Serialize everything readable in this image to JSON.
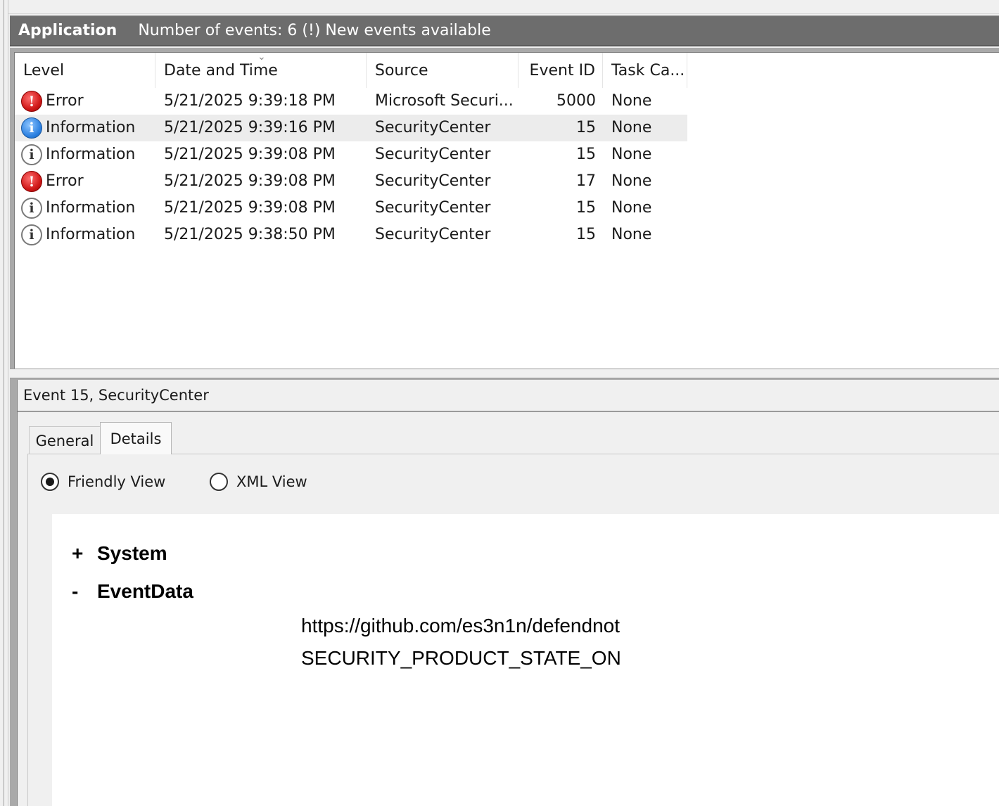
{
  "header": {
    "title": "Application",
    "info": "Number of events: 6 (!) New events available"
  },
  "columns": {
    "level": "Level",
    "datetime": "Date and Time",
    "source": "Source",
    "event_id": "Event ID",
    "task_category": "Task Ca..."
  },
  "events": [
    {
      "level": "Error",
      "icon": "error-icon",
      "datetime": "5/21/2025 9:39:18 PM",
      "source": "Microsoft Securi...",
      "event_id": "5000",
      "task_category": "None"
    },
    {
      "level": "Information",
      "icon": "info-icon",
      "datetime": "5/21/2025 9:39:16 PM",
      "source": "SecurityCenter",
      "event_id": "15",
      "task_category": "None"
    },
    {
      "level": "Information",
      "icon": "info-icon",
      "datetime": "5/21/2025 9:39:08 PM",
      "source": "SecurityCenter",
      "event_id": "15",
      "task_category": "None"
    },
    {
      "level": "Error",
      "icon": "error-icon",
      "datetime": "5/21/2025 9:39:08 PM",
      "source": "SecurityCenter",
      "event_id": "17",
      "task_category": "None"
    },
    {
      "level": "Information",
      "icon": "info-icon",
      "datetime": "5/21/2025 9:39:08 PM",
      "source": "SecurityCenter",
      "event_id": "15",
      "task_category": "None"
    },
    {
      "level": "Information",
      "icon": "info-icon",
      "datetime": "5/21/2025 9:38:50 PM",
      "source": "SecurityCenter",
      "event_id": "15",
      "task_category": "None"
    }
  ],
  "details": {
    "event_title": "Event 15, SecurityCenter",
    "tabs": [
      "General",
      "Details"
    ],
    "active_tab": "Details",
    "views": {
      "friendly": "Friendly View",
      "xml": "XML View",
      "selected": "Friendly View"
    },
    "tree": {
      "system": {
        "toggle": "+",
        "label": "System"
      },
      "eventdata": {
        "toggle": "-",
        "label": "EventData"
      }
    },
    "event_data_values": [
      "https://github.com/es3n1n/defendnot",
      "SECURITY_PRODUCT_STATE_ON"
    ]
  },
  "colors": {
    "header_bg": "#6d6d6d",
    "selected_row_bg": "#ececec",
    "error_red": "#d11a1a",
    "info_blue": "#2a7fe0"
  }
}
